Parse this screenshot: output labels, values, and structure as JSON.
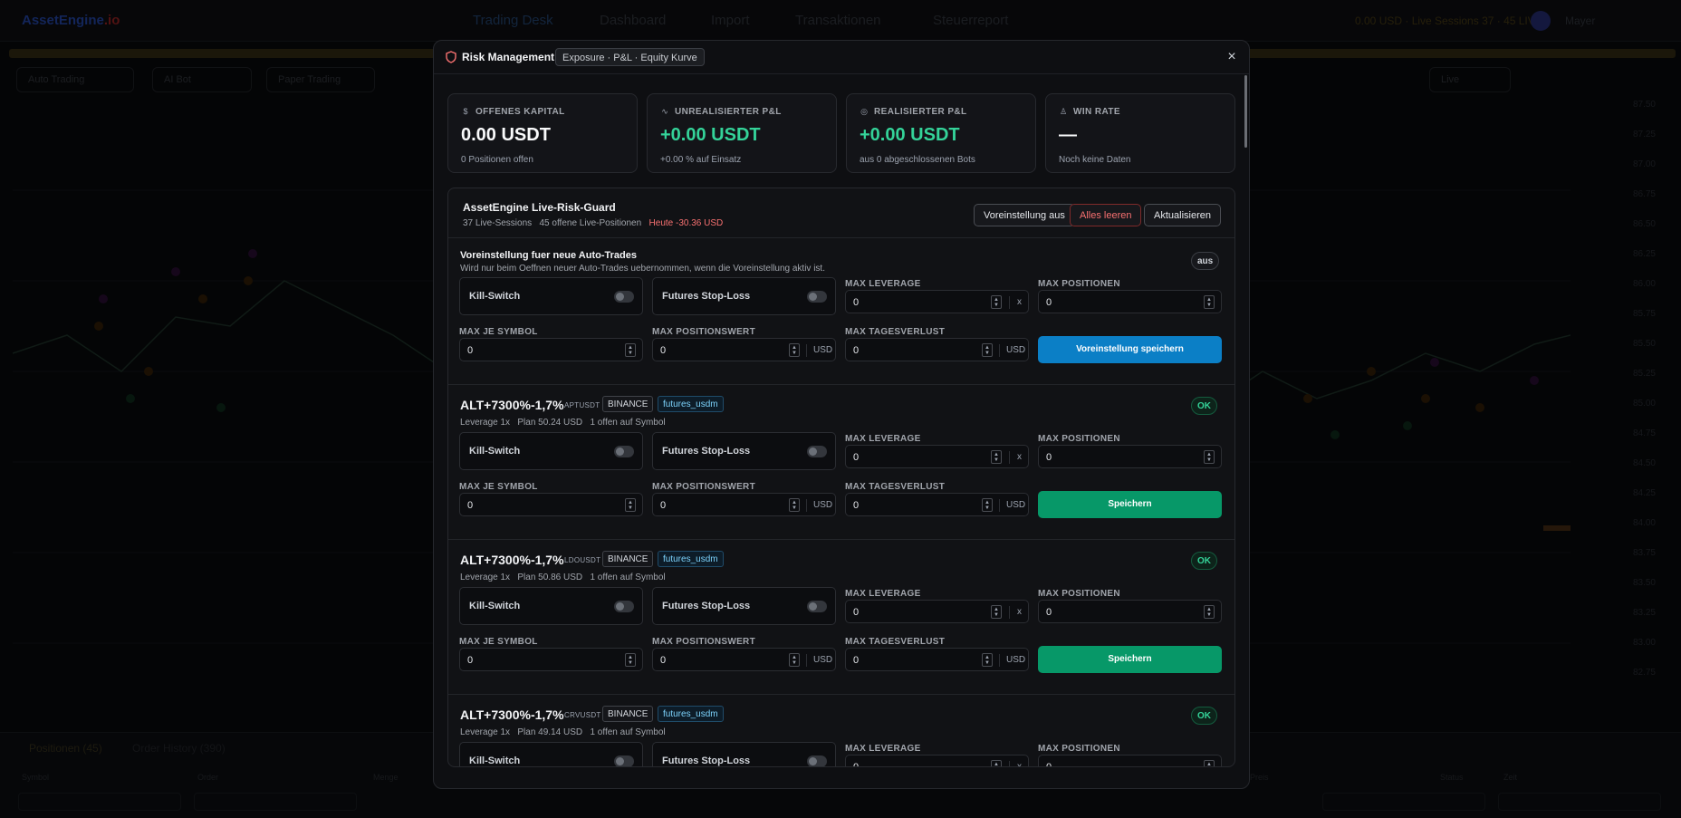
{
  "background": {
    "logo_a": "AssetEngine",
    "logo_b": ".io",
    "nav": [
      "Trading Desk",
      "Dashboard",
      "Import",
      "Transaktionen",
      "Steuerreport"
    ],
    "stats": "0.00 USD · Live Sessions 37 · 45 LIVE",
    "user": "Mayer",
    "toolbar": [
      "Auto Trading",
      "AI Bot",
      "Paper Trading",
      "Live"
    ],
    "axis": [
      "87.50",
      "87.25",
      "87.00",
      "86.75",
      "86.50",
      "86.25",
      "86.00",
      "85.75",
      "85.50",
      "85.25",
      "85.00",
      "84.75",
      "84.50",
      "84.25",
      "84.00",
      "83.75",
      "83.50",
      "83.25",
      "83.00",
      "82.75"
    ],
    "bottom_tabs": [
      "Positionen (45)",
      "Order History (390)"
    ],
    "bottom_cols": [
      "Symbol",
      "Order",
      "Menge",
      "Preis",
      "Status",
      "Zeit"
    ]
  },
  "modal": {
    "title": "Risk Management",
    "subtitle": "Exposure · P&L · Equity Kurve",
    "stats": [
      {
        "icon": "$",
        "label": "OFFENES KAPITAL",
        "value": "0.00 USDT",
        "sub": "0 Positionen offen",
        "accent": "#f9fafb"
      },
      {
        "icon": "∿",
        "label": "UNREALISIERTER P&L",
        "value": "+0.00 USDT",
        "sub": "+0.00 % auf Einsatz",
        "accent": "#34d399"
      },
      {
        "icon": "◎",
        "label": "REALISIERTER P&L",
        "value": "+0.00 USDT",
        "sub": "aus 0 abgeschlossenen Bots",
        "accent": "#34d399"
      },
      {
        "icon": "♙",
        "label": "WIN RATE",
        "value": "—",
        "sub": "Noch keine Daten",
        "accent": "#f9fafb"
      }
    ],
    "guard": {
      "title": "AssetEngine Live-Risk-Guard",
      "sessions": "37 Live-Sessions",
      "positions": "45 offene Live-Positionen",
      "today": "Heute -30.36 USD",
      "buttons": {
        "preset_off": "Voreinstellung aus",
        "clear_all": "Alles leeren",
        "refresh": "Aktualisieren"
      }
    },
    "preset": {
      "title": "Voreinstellung fuer neue Auto-Trades",
      "desc": "Wird nur beim Oeffnen neuer Auto-Trades uebernommen, wenn die Voreinstellung aktiv ist.",
      "status": "aus",
      "save_label": "Voreinstellung speichern"
    },
    "fields": {
      "kill_switch": "Kill-Switch",
      "futures_sl": "Futures Stop-Loss",
      "max_leverage": "MAX LEVERAGE",
      "max_positions": "MAX POSITIONEN",
      "max_per_symbol": "MAX JE SYMBOL",
      "max_position_value": "MAX POSITIONSWERT",
      "max_daily_loss": "MAX TAGESVERLUST",
      "unit_x": "x",
      "unit_usd": "USD",
      "save": "Speichern",
      "zero": "0"
    },
    "bots": [
      {
        "name": "ALT+7300%-1,7%",
        "symbol": "APTUSDT",
        "exchange": "BINANCE",
        "market": "futures_usdm",
        "leverage": "Leverage 1x",
        "plan": "Plan 50.24 USD",
        "open": "1 offen auf Symbol",
        "status": "OK"
      },
      {
        "name": "ALT+7300%-1,7%",
        "symbol": "LDOUSDT",
        "exchange": "BINANCE",
        "market": "futures_usdm",
        "leverage": "Leverage 1x",
        "plan": "Plan 50.86 USD",
        "open": "1 offen auf Symbol",
        "status": "OK"
      },
      {
        "name": "ALT+7300%-1,7%",
        "symbol": "CRVUSDT",
        "exchange": "BINANCE",
        "market": "futures_usdm",
        "leverage": "Leverage 1x",
        "plan": "Plan 49.14 USD",
        "open": "1 offen auf Symbol",
        "status": "OK"
      }
    ],
    "colors": {
      "primary": "#0b7fc6",
      "save": "#079868",
      "ok": "#34d399",
      "danger": "#f87171"
    }
  }
}
